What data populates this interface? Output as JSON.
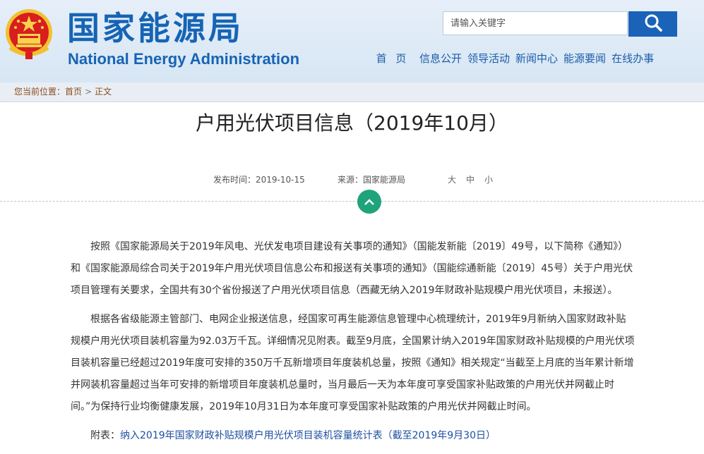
{
  "header": {
    "site_title_cn": "国家能源局",
    "site_title_en": "National Energy Administration",
    "search": {
      "placeholder": "请输入关键字"
    },
    "nav": [
      {
        "label": "首 页"
      },
      {
        "label": "信息公开"
      },
      {
        "label": "领导活动"
      },
      {
        "label": "新闻中心"
      },
      {
        "label": "能源要闻"
      },
      {
        "label": "在线办事"
      }
    ]
  },
  "breadcrumb": {
    "prefix": "您当前位置：",
    "items": [
      "首页",
      "正文"
    ],
    "separator": ">"
  },
  "article": {
    "title": "户用光伏项目信息（2019年10月）",
    "publish_time": "发布时间：2019-10-15",
    "source": "来源：国家能源局",
    "font_sizes": [
      "大",
      "中",
      "小"
    ],
    "paragraphs": [
      "按照《国家能源局关于2019年风电、光伏发电项目建设有关事项的通知》（国能发新能〔2019〕49号，以下简称《通知》）和《国家能源局综合司关于2019年户用光伏项目信息公布和报送有关事项的通知》（国能综通新能〔2019〕45号）关于户用光伏项目管理有关要求，全国共有30个省份报送了户用光伏项目信息（西藏无纳入2019年财政补贴规模户用光伏项目，未报送）。",
      "根据各省级能源主管部门、电网企业报送信息，经国家可再生能源信息管理中心梳理统计，2019年9月新纳入国家财政补贴规模户用光伏项目装机容量为92.03万千瓦。详细情况见附表。截至9月底，全国累计纳入2019年国家财政补贴规模的户用光伏项目装机容量已经超过2019年度可安排的350万千瓦新增项目年度装机总量，按照《通知》相关规定“当截至上月底的当年累计新增并网装机容量超过当年可安排的新增项目年度装机总量时，当月最后一天为本年度可享受国家补贴政策的户用光伏并网截止时间。”为保持行业均衡健康发展，2019年10月31日为本年度可享受国家补贴政策的户用光伏并网截止时间。"
    ],
    "attachment_prefix": "附表：",
    "attachment_link": "纳入2019年国家财政补贴规模户用光伏项目装机容量统计表（截至2019年9月30日）"
  },
  "colors": {
    "brand_blue": "#1664b4",
    "header_bg": "#ddeaf7",
    "search_button": "#1b63b8",
    "toggle_green": "#1fa37b",
    "breadcrumb_text": "#8a4b1f",
    "link_blue": "#1e4fa0"
  },
  "icons": {
    "emblem": "national-emblem-icon",
    "search": "search-icon",
    "toggle": "chevron-up-icon"
  }
}
